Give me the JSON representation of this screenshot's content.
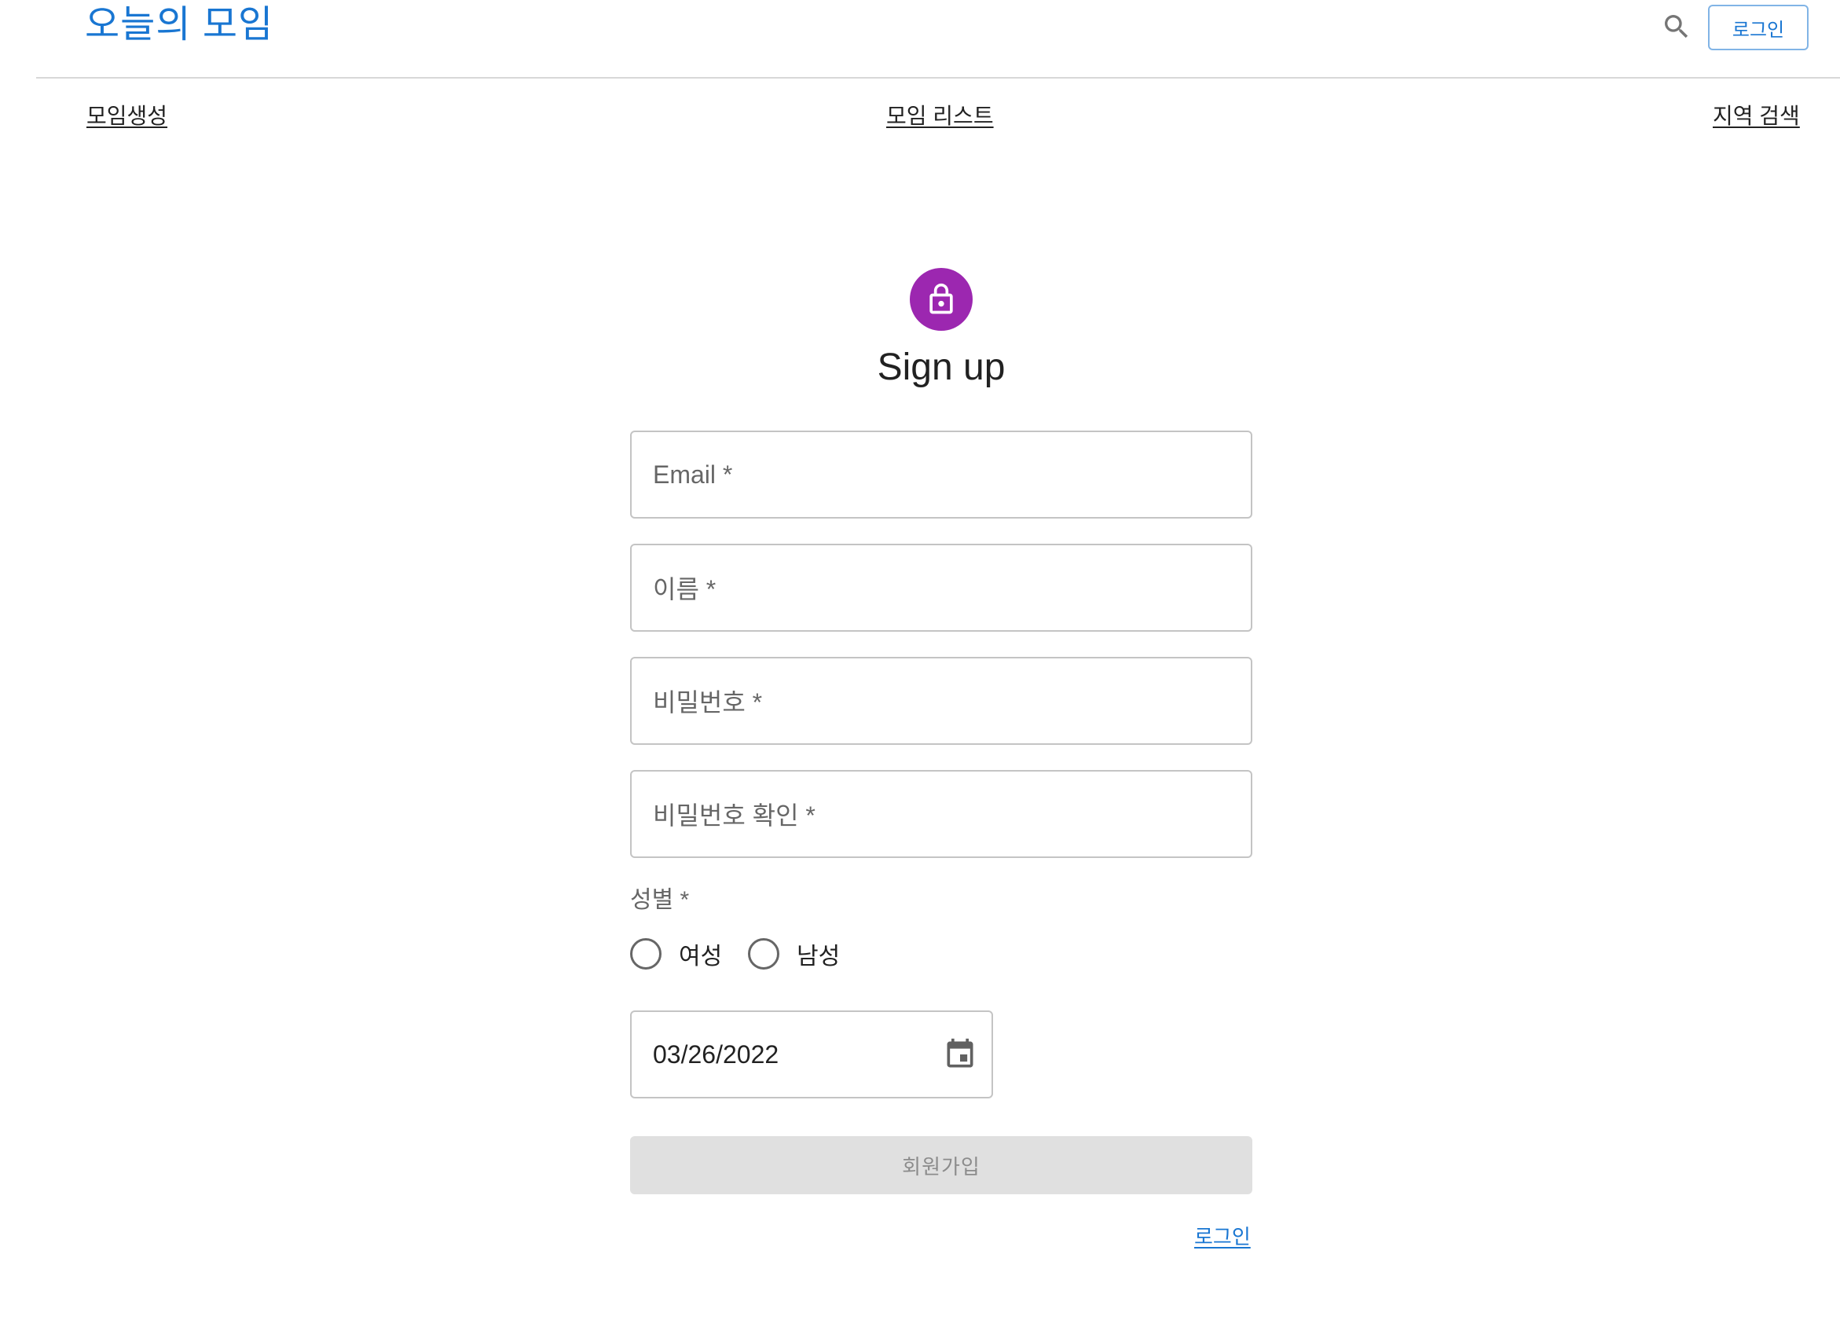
{
  "header": {
    "site_title": "오늘의 모임",
    "search_icon": "search-icon",
    "login_button": "로그인"
  },
  "nav": {
    "create": "모임생성",
    "list": "모임 리스트",
    "region_search": "지역 검색"
  },
  "form": {
    "icon": "lock-icon",
    "icon_bg_color": "#9c27b0",
    "title": "Sign up",
    "email_label": "Email *",
    "name_label": "이름 *",
    "password_label": "비밀번호 *",
    "password_confirm_label": "비밀번호 확인 *",
    "gender_label": "성별 *",
    "gender_options": [
      "여성",
      "남성"
    ],
    "birth_date": "03/26/2022",
    "calendar_icon": "calendar-icon",
    "submit_label": "회원가입",
    "login_link": "로그인"
  },
  "colors": {
    "primary": "#1976d2",
    "disabled_bg": "#e0e0e0"
  }
}
